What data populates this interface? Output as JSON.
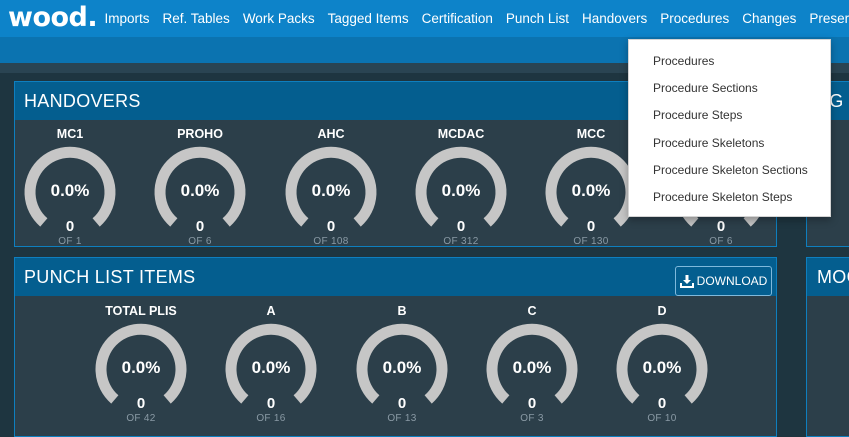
{
  "topbar": {
    "logo": "wood.",
    "nav": [
      "Imports",
      "Ref. Tables",
      "Work Packs",
      "Tagged Items",
      "Certification",
      "Punch List",
      "Handovers",
      "Procedures",
      "Changes",
      "Preservation"
    ]
  },
  "handovers": {
    "title": "HANDOVERS",
    "gauges": [
      {
        "label": "MC1",
        "percent": "0.0%",
        "value": "0",
        "total": "OF 1"
      },
      {
        "label": "PROHO",
        "percent": "0.0%",
        "value": "0",
        "total": "OF 6"
      },
      {
        "label": "AHC",
        "percent": "0.0%",
        "value": "0",
        "total": "OF 108"
      },
      {
        "label": "MCDAC",
        "percent": "0.0%",
        "value": "0",
        "total": "OF 312"
      },
      {
        "label": "MCC",
        "percent": "0.0%",
        "value": "0",
        "total": "OF 130"
      },
      {
        "label": "",
        "percent": "",
        "value": "0",
        "total": "OF 6"
      }
    ]
  },
  "punch_list": {
    "title": "PUNCH LIST ITEMS",
    "download_label": "DOWNLOAD",
    "gauges": [
      {
        "label": "TOTAL PLIS",
        "percent": "0.0%",
        "value": "0",
        "total": "OF 42"
      },
      {
        "label": "A",
        "percent": "0.0%",
        "value": "0",
        "total": "OF 16"
      },
      {
        "label": "B",
        "percent": "0.0%",
        "value": "0",
        "total": "OF 13"
      },
      {
        "label": "C",
        "percent": "0.0%",
        "value": "0",
        "total": "OF 3"
      },
      {
        "label": "D",
        "percent": "0.0%",
        "value": "0",
        "total": "OF 10"
      }
    ]
  },
  "side_panels": {
    "top_partial_title": "AG",
    "bottom_partial_title": "MOC"
  },
  "procedures_menu": {
    "items": [
      "Procedures",
      "Procedure Sections",
      "Procedure Steps",
      "Procedure Skeletons",
      "Procedure Skeleton Sections",
      "Procedure Skeleton Steps"
    ]
  },
  "colors": {
    "topbar": "#0d83c9",
    "panel_header": "#045e8f",
    "gauge_track": "#c6c6c6",
    "background": "#1e3540"
  }
}
